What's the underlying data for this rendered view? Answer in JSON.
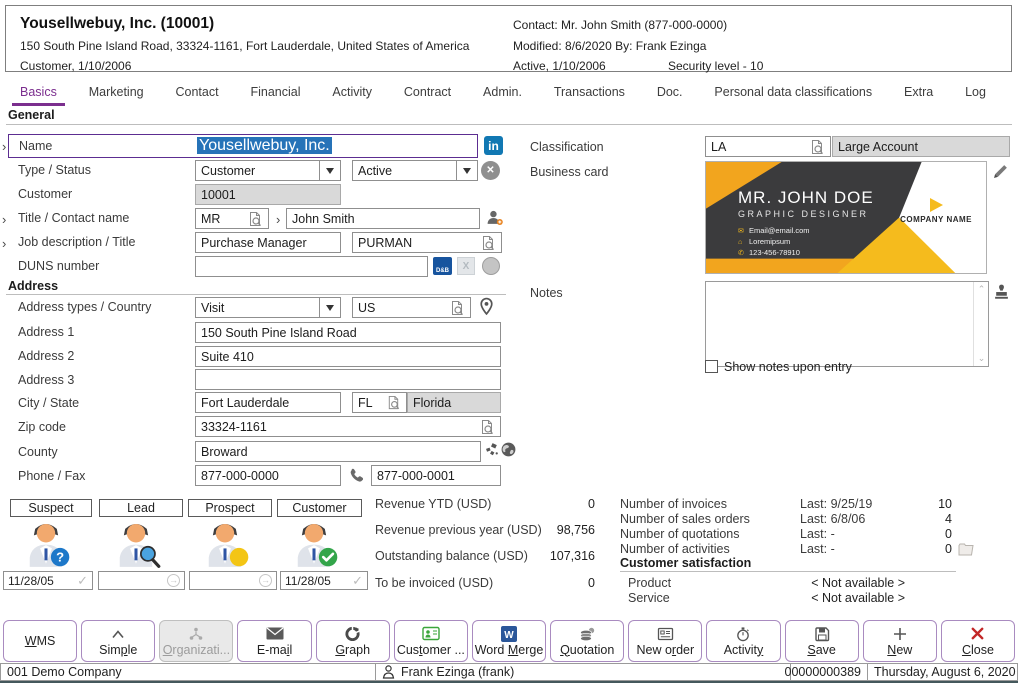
{
  "header": {
    "title": "Yousellwebuy, Inc. (10001)",
    "address_line": "150 South Pine Island Road, 33324-1161, Fort Lauderdale, United States of America",
    "status_line": "Customer, 1/10/2006",
    "contact": "Contact: Mr. John Smith (877-000-0000)",
    "modified": "Modified: 8/6/2020  By: Frank Ezinga",
    "active": "Active, 1/10/2006",
    "security": "Security level - 10"
  },
  "tabs": [
    "Basics",
    "Marketing",
    "Contact",
    "Financial",
    "Activity",
    "Contract",
    "Admin.",
    "Transactions",
    "Doc.",
    "Personal data classifications",
    "Extra",
    "Log"
  ],
  "sections": {
    "general": "General",
    "address": "Address"
  },
  "form": {
    "name": {
      "label": "Name",
      "value": "Yousellwebuy, Inc."
    },
    "type_status": {
      "label": "Type / Status",
      "type": "Customer",
      "status": "Active"
    },
    "customer": {
      "label": "Customer",
      "value": "10001"
    },
    "title_contact": {
      "label": "Title / Contact name",
      "title": "MR",
      "contact": "John Smith"
    },
    "job": {
      "label": "Job description / Title",
      "description": "Purchase Manager",
      "code": "PURMAN"
    },
    "duns": {
      "label": "DUNS number",
      "value": ""
    },
    "address_type": {
      "label": "Address types / Country",
      "type": "Visit",
      "country": "US"
    },
    "address1": {
      "label": "Address 1",
      "value": "150 South Pine Island Road"
    },
    "address2": {
      "label": "Address 2",
      "value": "Suite 410"
    },
    "address3": {
      "label": "Address 3",
      "value": ""
    },
    "city_state": {
      "label": "City / State",
      "city": "Fort Lauderdale",
      "state": "FL",
      "state_name": "Florida"
    },
    "zip": {
      "label": "Zip code",
      "value": "33324-1161"
    },
    "county": {
      "label": "County",
      "value": "Broward"
    },
    "phone_fax": {
      "label": "Phone / Fax",
      "phone": "877-000-0000",
      "fax": "877-000-0001"
    },
    "classification": {
      "label": "Classification",
      "code": "LA",
      "name": "Large Account"
    },
    "business_card_label": "Business card",
    "notes": {
      "label": "Notes",
      "value": ""
    },
    "show_notes_label": "Show notes upon entry"
  },
  "business_card": {
    "name": "MR. JOHN DOE",
    "job": "GRAPHIC DESIGNER",
    "email": "Email@email.com",
    "address": "Loremipsum",
    "phone": "123-456-78910",
    "company": "COMPANY NAME"
  },
  "stages": [
    {
      "label": "Suspect",
      "date": "11/28/05"
    },
    {
      "label": "Lead",
      "date": ""
    },
    {
      "label": "Prospect",
      "date": ""
    },
    {
      "label": "Customer",
      "date": "11/28/05"
    }
  ],
  "financials": [
    {
      "label": "Revenue YTD (USD)",
      "value": "0"
    },
    {
      "label": "Revenue previous year (USD)",
      "value": "98,756"
    },
    {
      "label": "Outstanding balance (USD)",
      "value": "107,316"
    },
    {
      "label": "To be invoiced (USD)",
      "value": "0"
    }
  ],
  "counters": [
    {
      "label": "Number of invoices",
      "last": "Last: 9/25/19",
      "count": "10"
    },
    {
      "label": "Number of sales orders",
      "last": "Last: 6/8/06",
      "count": "4"
    },
    {
      "label": "Number of quotations",
      "last": "Last: -",
      "count": "0"
    },
    {
      "label": "Number of activities",
      "last": "Last: -",
      "count": "0"
    }
  ],
  "satisfaction": {
    "title": "Customer satisfaction",
    "rows": [
      {
        "label": "Product",
        "value": "< Not available >"
      },
      {
        "label": "Service",
        "value": "< Not available >"
      }
    ]
  },
  "toolbar": [
    {
      "label": "WMS",
      "accel": 0
    },
    {
      "label": "Simple",
      "accel": 3
    },
    {
      "label": "Organizati...",
      "accel": 0
    },
    {
      "label": "E-mail",
      "accel": 4
    },
    {
      "label": "Graph",
      "accel": 0
    },
    {
      "label": "Customer ...",
      "accel": 3
    },
    {
      "label": "Word Merge",
      "accel": 5
    },
    {
      "label": "Quotation",
      "accel": 0
    },
    {
      "label": "New order",
      "accel": 5
    },
    {
      "label": "Activity",
      "accel": 7
    },
    {
      "label": "Save",
      "accel": 0
    },
    {
      "label": "New",
      "accel": 0
    },
    {
      "label": "Close",
      "accel": 0
    }
  ],
  "statusbar": {
    "company": "001 Demo Company",
    "user": "Frank Ezinga (frank)",
    "record_id": "00000000389",
    "date": "Thursday, August 6, 2020"
  },
  "colors": {
    "accent_purple": "#7b2e8e",
    "selection_blue": "#2673b8",
    "linkedin_blue": "#1178b3",
    "card_orange": "#f2a51e",
    "card_yellow": "#f5bb1d",
    "card_dark": "#3b3b3d",
    "customer_green": "#33a54a",
    "prospect_yellow": "#f3c515",
    "suspect_blue": "#1d78c9",
    "close_red": "#c22727"
  }
}
